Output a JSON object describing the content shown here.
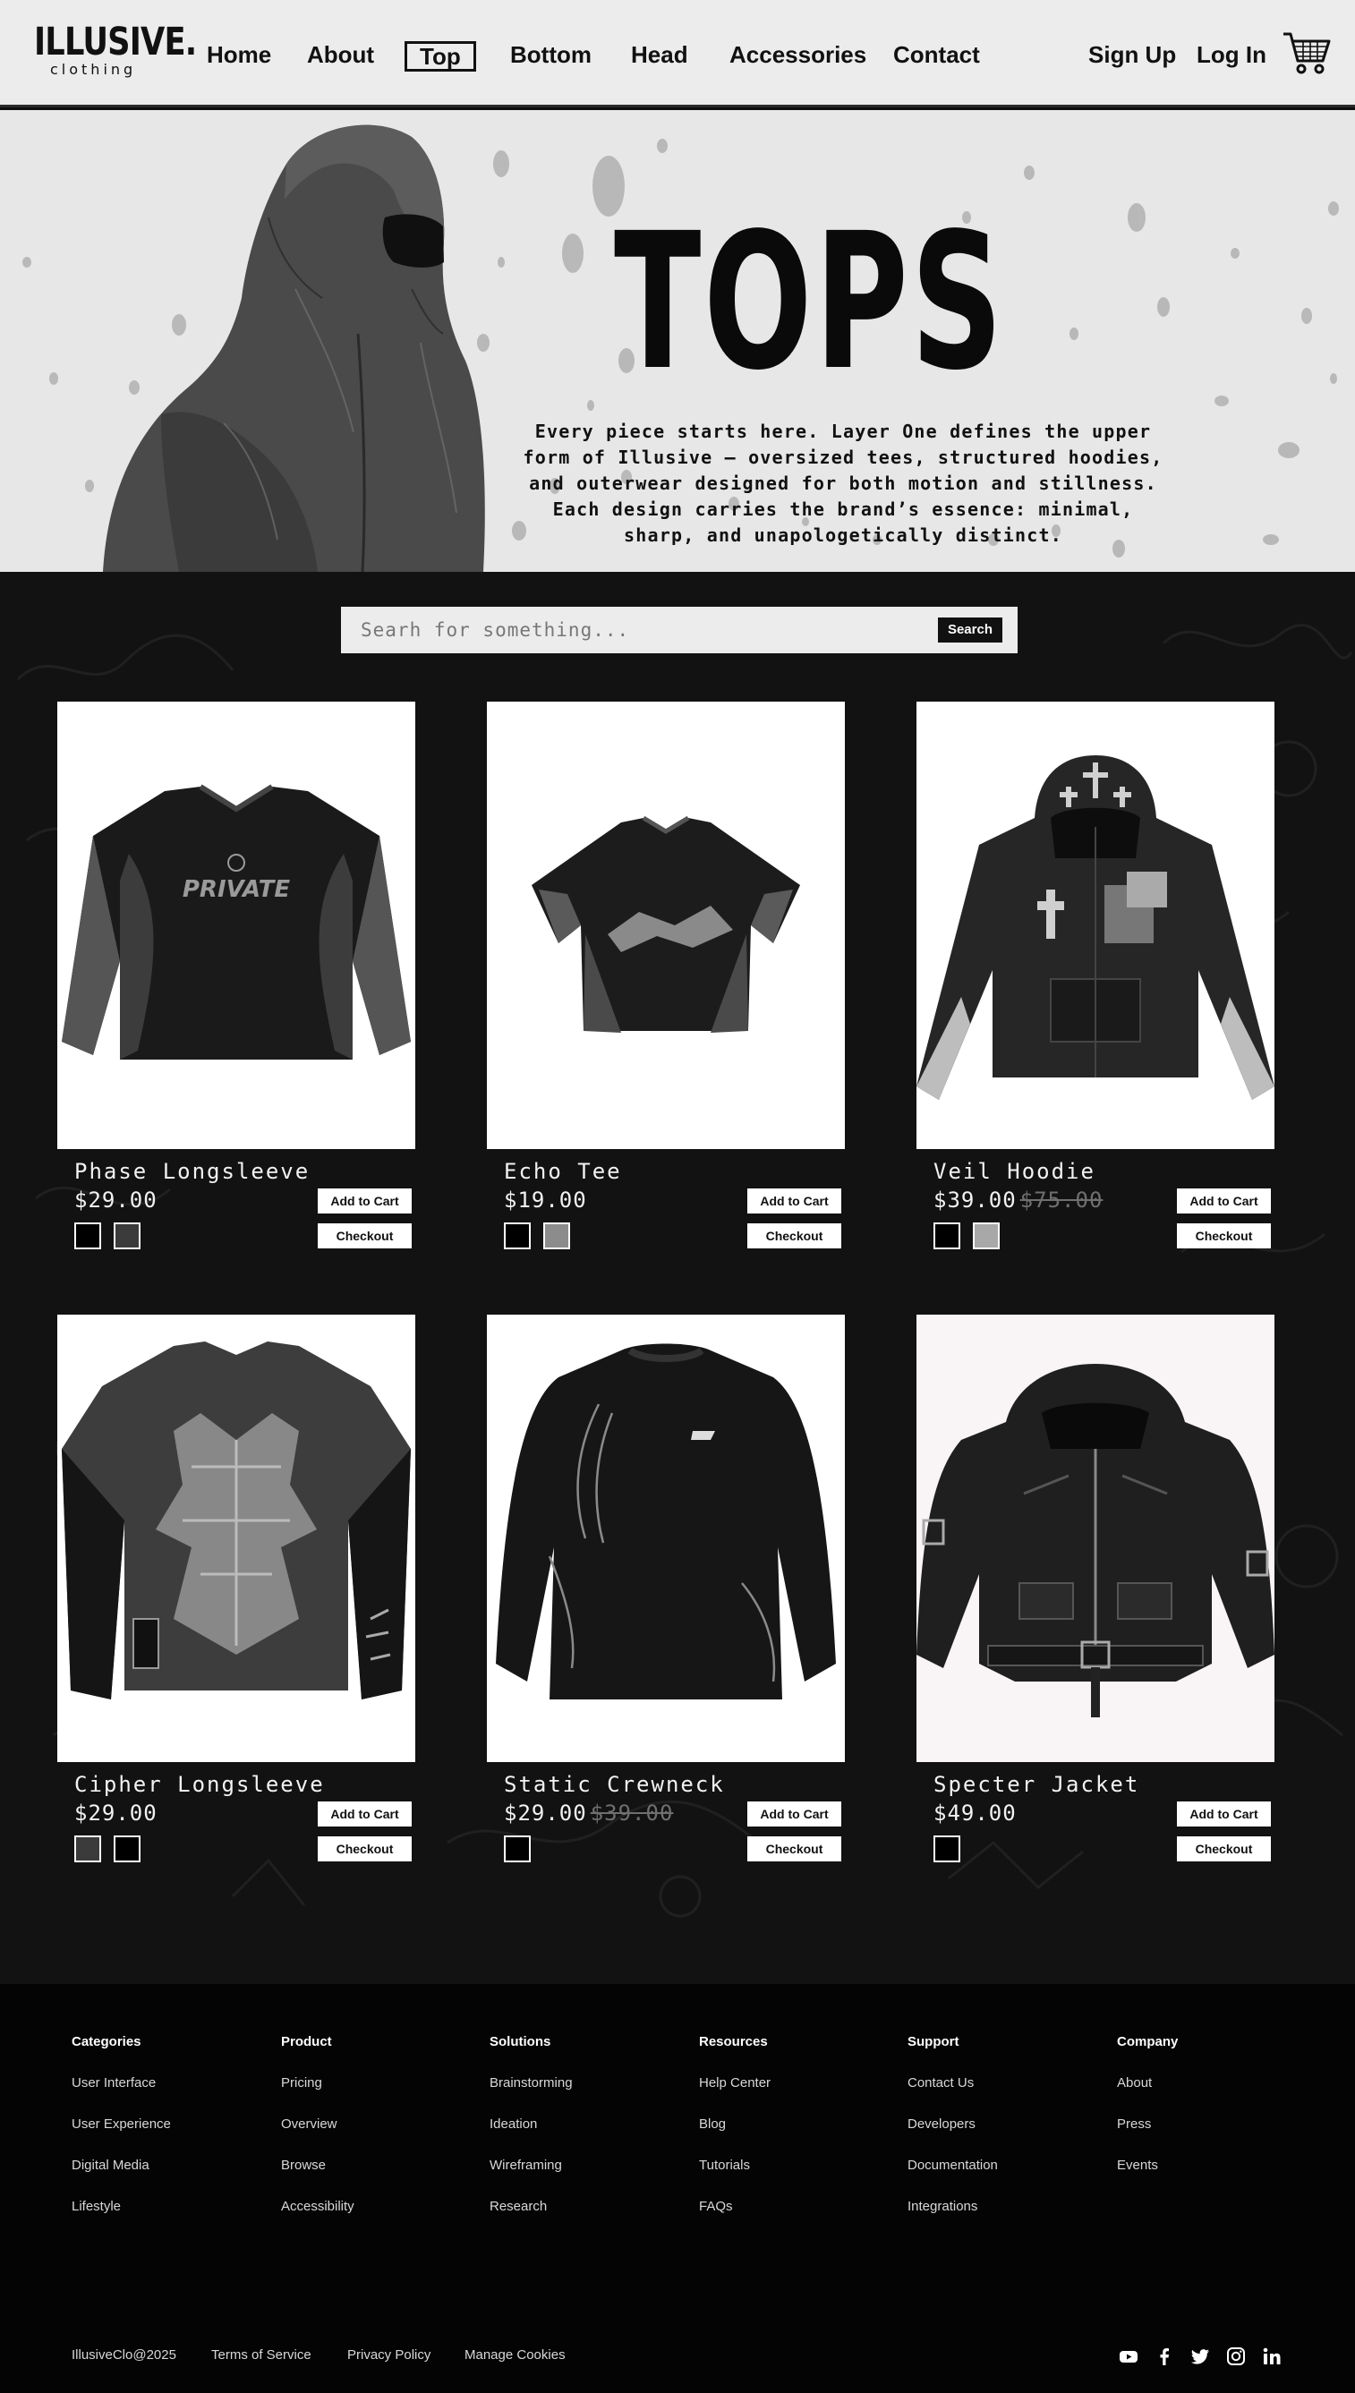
{
  "brand": {
    "name": "ILLUSIVE.",
    "sub": "clothing"
  },
  "nav": {
    "links": [
      "Home",
      "About",
      "Top",
      "Bottom",
      "Head",
      "Accessories",
      "Contact"
    ],
    "active": "Top",
    "sign_up": "Sign Up",
    "log_in": "Log In",
    "cart_icon": "shopping-cart-icon"
  },
  "hero": {
    "title": "TOPS",
    "description": "Every piece starts here. Layer One defines the upper form of Illusive — oversized tees, structured hoodies, and outerwear designed for both motion and stillness. Each design carries the brand’s essence: minimal, sharp, and unapologetically distinct."
  },
  "search": {
    "placeholder": "Searh for something...",
    "button": "Search"
  },
  "products": [
    {
      "name": "Phase Longsleeve",
      "price": "$29.00",
      "old_price": "",
      "swatches": [
        "#000000",
        "#3b3b3b"
      ]
    },
    {
      "name": "Echo Tee",
      "price": "$19.00",
      "old_price": "",
      "swatches": [
        "#000000",
        "#8c8c8c"
      ]
    },
    {
      "name": "Veil Hoodie",
      "price": "$39.00",
      "old_price": "$75.00",
      "swatches": [
        "#000000",
        "#a8a8a8"
      ]
    },
    {
      "name": "Cipher Longsleeve",
      "price": "$29.00",
      "old_price": "",
      "swatches": [
        "#3b3b3b",
        "#000000"
      ]
    },
    {
      "name": "Static Crewneck",
      "price": "$29.00",
      "old_price": "$39.00",
      "swatches": [
        "#000000"
      ]
    },
    {
      "name": "Specter Jacket",
      "price": "$49.00",
      "old_price": "",
      "swatches": [
        "#000000"
      ]
    }
  ],
  "buttons": {
    "add_to_cart": "Add to Cart",
    "checkout": "Checkout"
  },
  "footer": {
    "columns": [
      {
        "heading": "Categories",
        "items": [
          "User Interface",
          "User Experience",
          "Digital Media",
          "Lifestyle"
        ]
      },
      {
        "heading": "Product",
        "items": [
          "Pricing",
          "Overview",
          "Browse",
          "Accessibility"
        ]
      },
      {
        "heading": "Solutions",
        "items": [
          "Brainstorming",
          "Ideation",
          "Wireframing",
          "Research"
        ]
      },
      {
        "heading": "Resources",
        "items": [
          "Help Center",
          "Blog",
          "Tutorials",
          "FAQs"
        ]
      },
      {
        "heading": "Support",
        "items": [
          "Contact Us",
          "Developers",
          "Documentation",
          "Integrations"
        ]
      },
      {
        "heading": "Company",
        "items": [
          "About",
          "Press",
          "Events"
        ]
      }
    ],
    "copyright": "IllusiveClo@2025",
    "links": [
      "Terms of Service",
      "Privacy Policy",
      "Manage Cookies"
    ],
    "social_icons": [
      "youtube-icon",
      "facebook-icon",
      "twitter-icon",
      "instagram-icon",
      "linkedin-icon"
    ]
  }
}
